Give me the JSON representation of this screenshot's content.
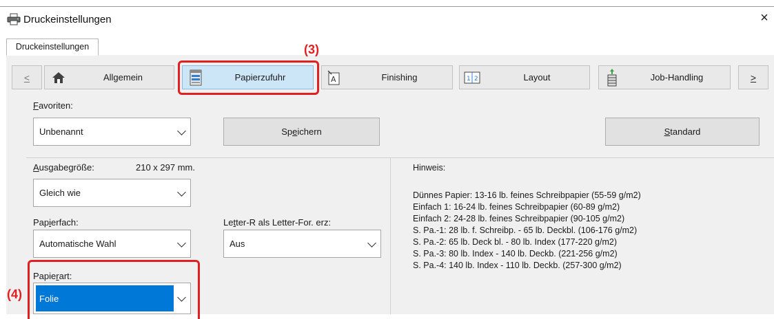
{
  "window": {
    "title": "Druckeinstellungen",
    "close_glyph": "×"
  },
  "tabs": [
    {
      "label": "Druckeinstellungen"
    }
  ],
  "nav": {
    "prev_glyph": "<",
    "next_glyph": ">",
    "items": [
      {
        "label": "Allgemein",
        "icon": "home-icon"
      },
      {
        "label": "Papierzufuhr",
        "icon": "paper-feed-icon",
        "selected": true
      },
      {
        "label": "Finishing",
        "icon": "finishing-icon"
      },
      {
        "label": "Layout",
        "icon": "layout-icon"
      },
      {
        "label": "Job-Handling",
        "icon": "job-handling-icon"
      }
    ]
  },
  "favorites": {
    "label_first": "F",
    "label_rest": "avoriten:",
    "value": "Unbenannt",
    "save_pre": "Sp",
    "save_u": "e",
    "save_post": "ichern",
    "standard_u": "S",
    "standard_rest": "tandard"
  },
  "output": {
    "label_u": "A",
    "label_rest": "usgabegröße:",
    "size_text": "210 x 297 mm.",
    "value": "Gleich wie"
  },
  "tray": {
    "label_pre": "Pap",
    "label_u": "i",
    "label_post": "erfach:",
    "value": "Automatische Wahl"
  },
  "letter": {
    "label_pre": "Le",
    "label_u": "t",
    "label_post": "ter-R als Letter-For. erz:",
    "value": "Aus"
  },
  "papertype": {
    "label_pre": "P",
    "label_mid": "apie",
    "label_u": "r",
    "label_post": "art:",
    "value": "Folie"
  },
  "hint": {
    "label": "Hinweis:",
    "lines": [
      "Dünnes Papier: 13-16 lb. feines Schreibpapier (55-59 g/m2)",
      "Einfach 1: 16-24 lb. feines Schreibpapier (60-89 g/m2)",
      "Einfach 2: 24-28 lb. feines Schreibpapier (90-105 g/m2)",
      "S. Pa.-1: 28 lb. f. Schreibp. - 65 lb. Deckbl. (106-176 g/m2)",
      "S. Pa.-2: 65 lb. Deck bl. - 80 lb. Index (177-220 g/m2)",
      "S. Pa.-3: 80 lb. Index - 140 lb. Deckb. (221-256 g/m2)",
      "S. Pa.-4: 140 lb. Index - 110 lb. Deckb. (257-300 g/m2)"
    ]
  },
  "annotations": {
    "step3": "(3)",
    "step4": "(4)"
  },
  "colors": {
    "highlight_red": "#e02020",
    "selected_blue": "#0078d7",
    "selected_tab": "#cde6f7"
  }
}
